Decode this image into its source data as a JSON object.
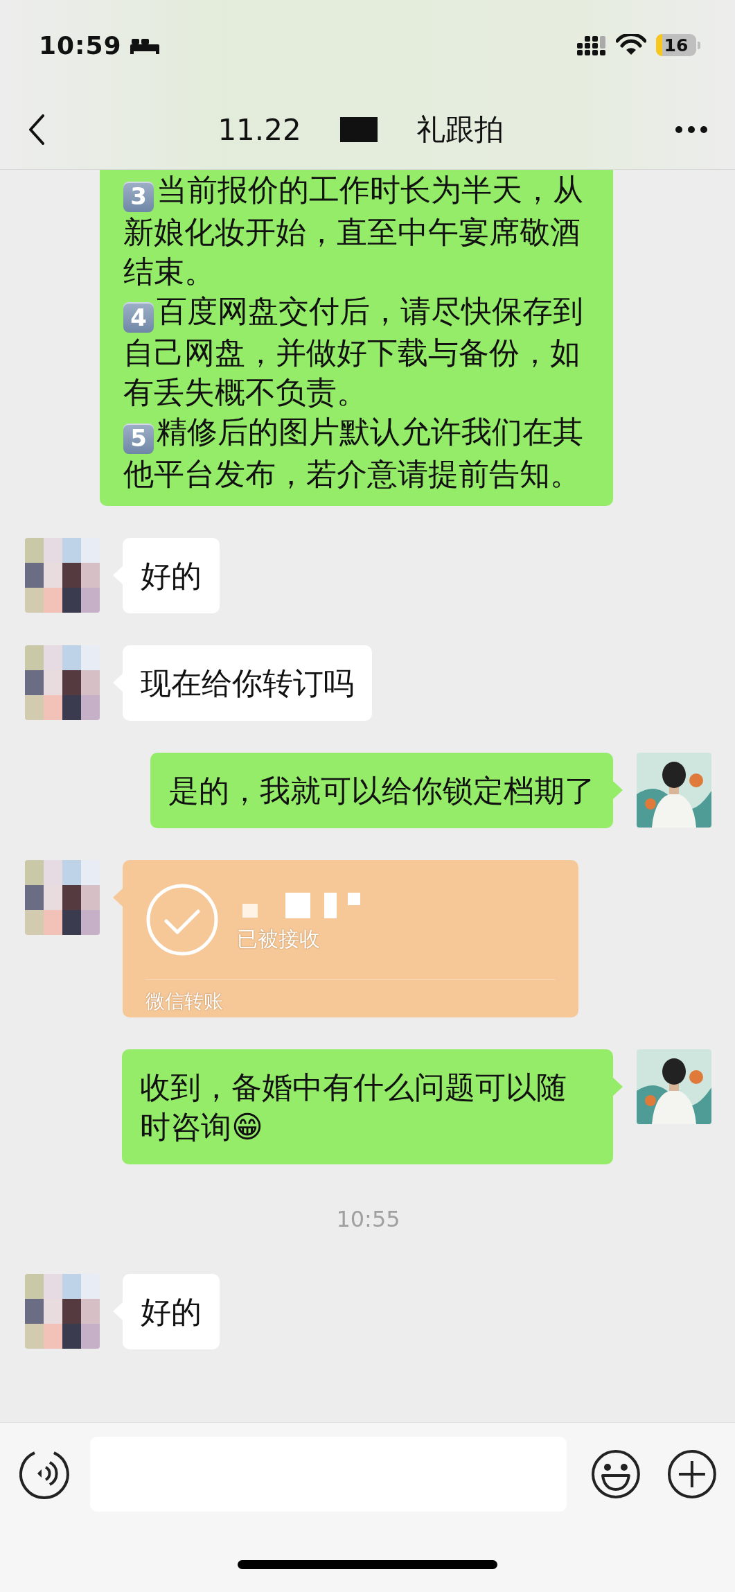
{
  "status_bar": {
    "time": "10:59",
    "battery": "16"
  },
  "nav": {
    "title_start": "11.22",
    "title_end": "礼跟拍"
  },
  "messages": [
    {
      "kind": "list",
      "outgoing": true,
      "items": [
        {
          "number": "3",
          "text": "当前报价的工作时长为半天，从新娘化妆开始，直至中午宴席敬酒结束。"
        },
        {
          "number": "4",
          "text": "百度网盘交付后，请尽快保存到自己网盘，并做好下载与备份，如有丢失概不负责。"
        },
        {
          "number": "5",
          "text": "精修后的图片默认允许我们在其他平台发布，若介意请提前告知。"
        }
      ]
    },
    {
      "kind": "text",
      "outgoing": false,
      "text": "好的"
    },
    {
      "kind": "text",
      "outgoing": false,
      "text": "现在给你转订吗"
    },
    {
      "kind": "text",
      "outgoing": true,
      "text": "是的，我就可以给你锁定档期了"
    },
    {
      "kind": "transfer",
      "outgoing": false,
      "status": "已被接收",
      "label": "微信转账"
    },
    {
      "kind": "text",
      "outgoing": true,
      "text": "收到，备婚中有什么问题可以随时咨询😁"
    },
    {
      "kind": "time",
      "text": "10:55"
    },
    {
      "kind": "text",
      "outgoing": false,
      "text": "好的"
    }
  ]
}
